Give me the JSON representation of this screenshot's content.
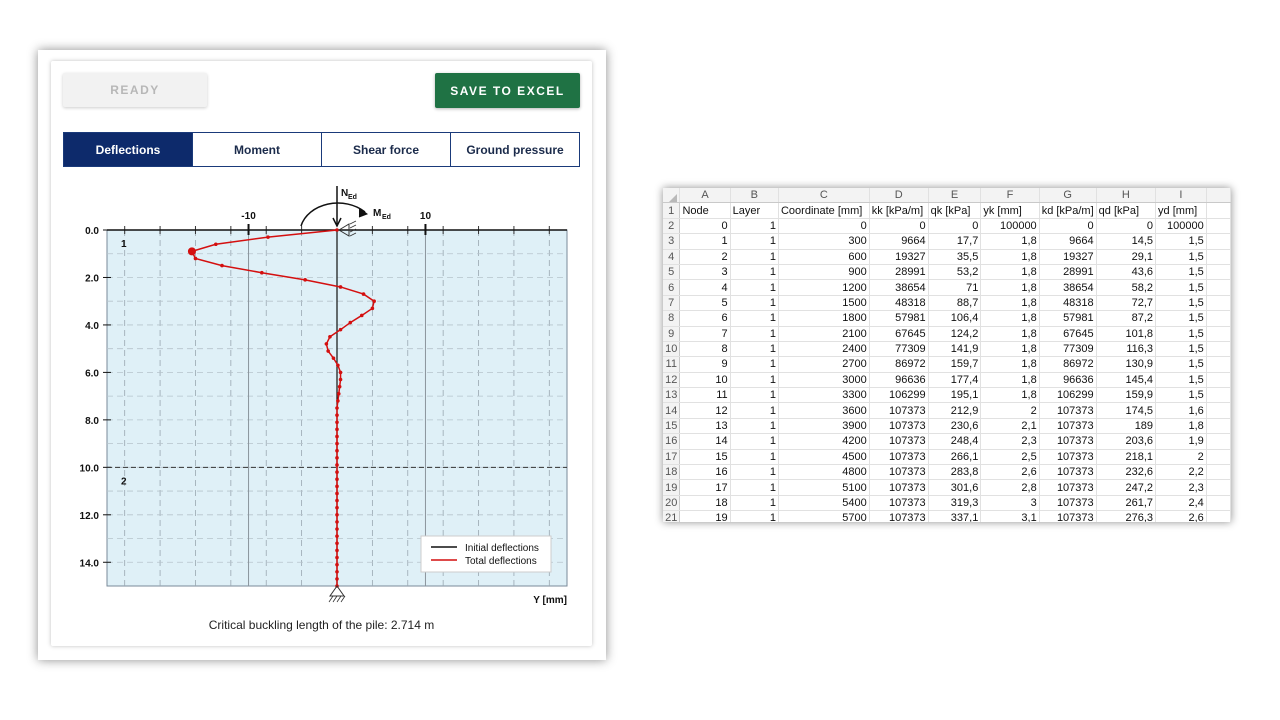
{
  "app": {
    "ready_label": "READY",
    "save_label": "SAVE TO EXCEL",
    "tabs": [
      {
        "label": "Deflections",
        "active": true
      },
      {
        "label": "Moment",
        "active": false
      },
      {
        "label": "Shear force",
        "active": false
      },
      {
        "label": "Ground pressure",
        "active": false
      }
    ],
    "caption": "Critical buckling length of the pile: 2.714 m",
    "colors": {
      "save_button": "#1f7244",
      "active_tab": "#0d2a6b",
      "plot_bg": "#dff0f7",
      "total_line": "#d40f0f"
    }
  },
  "chart_data": {
    "type": "line",
    "orientation": "vertical-depth",
    "x_top_tick_labels": [
      "-10",
      "10"
    ],
    "x_ticks": [
      -10,
      10
    ],
    "xlim": [
      -26,
      26
    ],
    "y_tick_labels": [
      "0.0",
      "2.0",
      "4.0",
      "6.0",
      "8.0",
      "10.0",
      "12.0",
      "14.0"
    ],
    "ylim": [
      0,
      15
    ],
    "xlabel": "Y [mm]",
    "layer_labels": [
      {
        "label": "1",
        "depth": 0
      },
      {
        "label": "2",
        "depth": 10
      }
    ],
    "layer_boundary_depth": 10,
    "load_labels": {
      "axial": "N",
      "axial_sub": "Ed",
      "moment": "M",
      "moment_sub": "Ed"
    },
    "legend_placement": "bottom-right",
    "series": [
      {
        "name": "Initial deflections",
        "color": "#111111",
        "x": [
          0,
          0
        ],
        "y": [
          0,
          15
        ]
      },
      {
        "name": "Total deflections",
        "color": "#d40f0f",
        "x": [
          0,
          -7.8,
          -13.7,
          -16.4,
          -16.0,
          -13,
          -8.5,
          -3.6,
          0.4,
          3.0,
          4.2,
          4.0,
          2.8,
          1.5,
          0.4,
          -0.8,
          -1.2,
          -1.0,
          -0.4,
          0.1,
          0.4,
          0.4,
          0.3,
          0.2,
          0.1,
          0,
          0,
          0,
          0,
          0,
          0,
          0,
          0,
          0,
          0,
          0,
          0,
          0,
          0,
          0,
          0,
          0,
          0,
          0,
          0,
          0,
          0,
          0,
          0,
          0,
          0
        ],
        "y": [
          0,
          0.3,
          0.6,
          0.9,
          1.2,
          1.5,
          1.8,
          2.1,
          2.4,
          2.7,
          3.0,
          3.3,
          3.6,
          3.9,
          4.2,
          4.5,
          4.8,
          5.1,
          5.4,
          5.7,
          6.0,
          6.3,
          6.6,
          6.9,
          7.2,
          7.5,
          7.8,
          8.1,
          8.4,
          8.7,
          9.0,
          9.3,
          9.6,
          9.9,
          10.2,
          10.5,
          10.8,
          11.1,
          11.4,
          11.7,
          12.0,
          12.3,
          12.6,
          12.9,
          13.2,
          13.5,
          13.8,
          14.1,
          14.4,
          14.7,
          15.0
        ]
      }
    ],
    "max_marker": {
      "x": -16.4,
      "y": 0.9
    }
  },
  "sheet": {
    "columns": [
      "A",
      "B",
      "C",
      "D",
      "E",
      "F",
      "G",
      "H",
      "I"
    ],
    "headers": [
      "Node",
      "Layer",
      "Coordinate [mm]",
      "kk [kPa/m]",
      "qk [kPa]",
      "yk [mm]",
      "kd [kPa/m]",
      "qd [kPa]",
      "yd [mm]"
    ],
    "rows": [
      [
        "0",
        "1",
        "0",
        "0",
        "0",
        "100000",
        "0",
        "0",
        "100000"
      ],
      [
        "1",
        "1",
        "300",
        "9664",
        "17,7",
        "1,8",
        "9664",
        "14,5",
        "1,5"
      ],
      [
        "2",
        "1",
        "600",
        "19327",
        "35,5",
        "1,8",
        "19327",
        "29,1",
        "1,5"
      ],
      [
        "3",
        "1",
        "900",
        "28991",
        "53,2",
        "1,8",
        "28991",
        "43,6",
        "1,5"
      ],
      [
        "4",
        "1",
        "1200",
        "38654",
        "71",
        "1,8",
        "38654",
        "58,2",
        "1,5"
      ],
      [
        "5",
        "1",
        "1500",
        "48318",
        "88,7",
        "1,8",
        "48318",
        "72,7",
        "1,5"
      ],
      [
        "6",
        "1",
        "1800",
        "57981",
        "106,4",
        "1,8",
        "57981",
        "87,2",
        "1,5"
      ],
      [
        "7",
        "1",
        "2100",
        "67645",
        "124,2",
        "1,8",
        "67645",
        "101,8",
        "1,5"
      ],
      [
        "8",
        "1",
        "2400",
        "77309",
        "141,9",
        "1,8",
        "77309",
        "116,3",
        "1,5"
      ],
      [
        "9",
        "1",
        "2700",
        "86972",
        "159,7",
        "1,8",
        "86972",
        "130,9",
        "1,5"
      ],
      [
        "10",
        "1",
        "3000",
        "96636",
        "177,4",
        "1,8",
        "96636",
        "145,4",
        "1,5"
      ],
      [
        "11",
        "1",
        "3300",
        "106299",
        "195,1",
        "1,8",
        "106299",
        "159,9",
        "1,5"
      ],
      [
        "12",
        "1",
        "3600",
        "107373",
        "212,9",
        "2",
        "107373",
        "174,5",
        "1,6"
      ],
      [
        "13",
        "1",
        "3900",
        "107373",
        "230,6",
        "2,1",
        "107373",
        "189",
        "1,8"
      ],
      [
        "14",
        "1",
        "4200",
        "107373",
        "248,4",
        "2,3",
        "107373",
        "203,6",
        "1,9"
      ],
      [
        "15",
        "1",
        "4500",
        "107373",
        "266,1",
        "2,5",
        "107373",
        "218,1",
        "2"
      ],
      [
        "16",
        "1",
        "4800",
        "107373",
        "283,8",
        "2,6",
        "107373",
        "232,6",
        "2,2"
      ],
      [
        "17",
        "1",
        "5100",
        "107373",
        "301,6",
        "2,8",
        "107373",
        "247,2",
        "2,3"
      ],
      [
        "18",
        "1",
        "5400",
        "107373",
        "319,3",
        "3",
        "107373",
        "261,7",
        "2,4"
      ],
      [
        "19",
        "1",
        "5700",
        "107373",
        "337,1",
        "3,1",
        "107373",
        "276,3",
        "2,6"
      ]
    ]
  }
}
